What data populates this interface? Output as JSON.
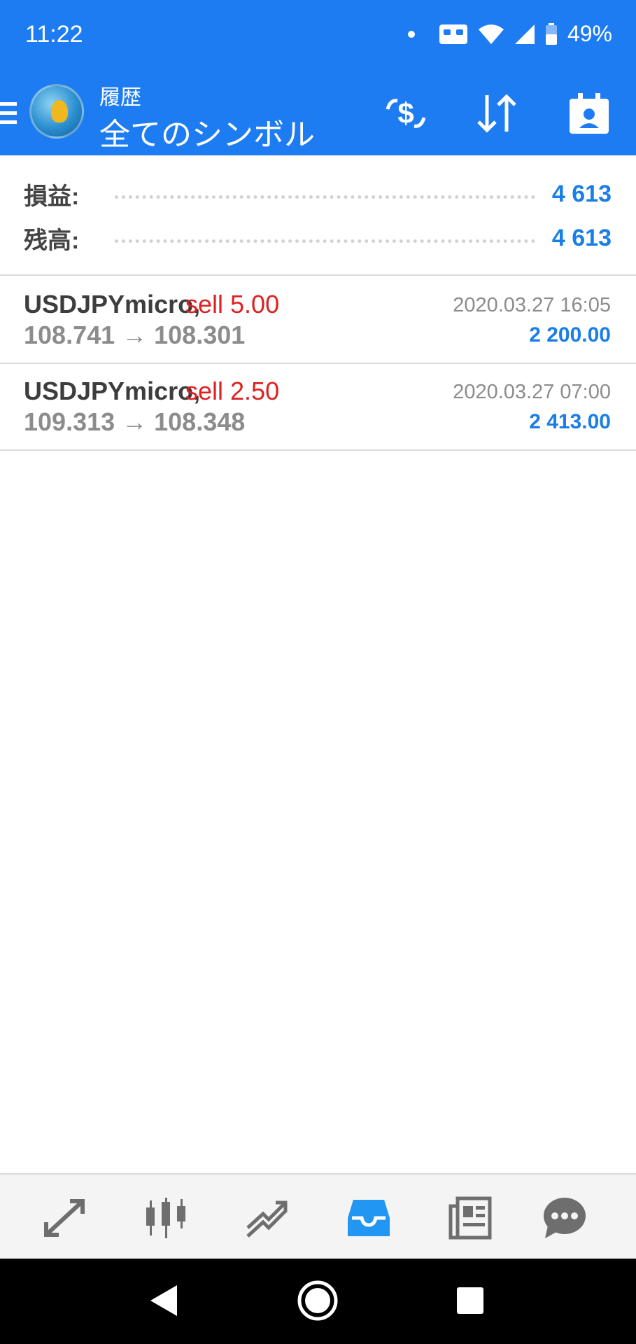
{
  "status_bar": {
    "time": "11:22",
    "battery": "49%"
  },
  "app_bar": {
    "title": "履歴",
    "subtitle": "全てのシンボル"
  },
  "summary": {
    "profit_label": "損益:",
    "profit_value": "4 613",
    "balance_label": "残高:",
    "balance_value": "4 613"
  },
  "deals": [
    {
      "symbol": "USDJPYmicro,",
      "side": "sell 5.00",
      "prices": "108.741 → 108.301",
      "time": "2020.03.27 16:05",
      "profit": "2 200.00"
    },
    {
      "symbol": "USDJPYmicro,",
      "side": "sell 2.50",
      "prices": "109.313 → 108.348",
      "time": "2020.03.27 07:00",
      "profit": "2 413.00"
    }
  ],
  "colors": {
    "accent": "#1e7cf2",
    "profit": "#1a7ee8",
    "sell": "#e02020"
  },
  "bottom_nav": [
    "quotes-icon",
    "chart-icon",
    "trade-icon",
    "history-icon",
    "news-icon",
    "chat-icon"
  ],
  "active_tab": "history-icon"
}
